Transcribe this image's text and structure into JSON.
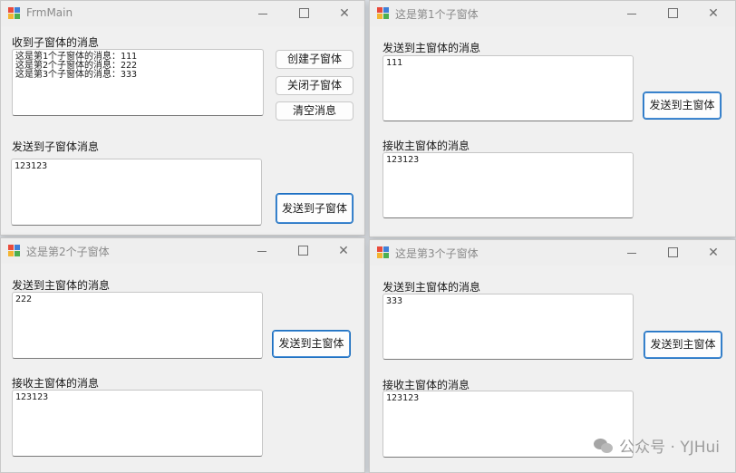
{
  "main_form": {
    "title": "FrmMain",
    "received_label": "收到子窗体的消息",
    "received_text": "这是第1个子窗体的消息：111\n这是第2个子窗体的消息：222\n这是第3个子窗体的消息：333",
    "create_button": "创建子窗体",
    "close_button": "关闭子窗体",
    "clear_button": "清空消息",
    "send_label": "发送到子窗体消息",
    "send_text": "123123",
    "send_button": "发送到子窗体"
  },
  "child1": {
    "title": "这是第1个子窗体",
    "send_label": "发送到主窗体的消息",
    "send_text": "111",
    "send_button": "发送到主窗体",
    "recv_label": "接收主窗体的消息",
    "recv_text": "123123"
  },
  "child2": {
    "title": "这是第2个子窗体",
    "send_label": "发送到主窗体的消息",
    "send_text": "222",
    "send_button": "发送到主窗体",
    "recv_label": "接收主窗体的消息",
    "recv_text": "123123"
  },
  "child3": {
    "title": "这是第3个子窗体",
    "send_label": "发送到主窗体的消息",
    "send_text": "333",
    "send_button": "发送到主窗体",
    "recv_label": "接收主窗体的消息",
    "recv_text": "123123"
  },
  "window_controls": {
    "minimize": "minimize-icon",
    "maximize": "maximize-icon",
    "close": "close-icon",
    "close_glyph": "✕"
  },
  "watermark": {
    "text": "公众号 · YJHui",
    "icon": "wechat-icon"
  }
}
